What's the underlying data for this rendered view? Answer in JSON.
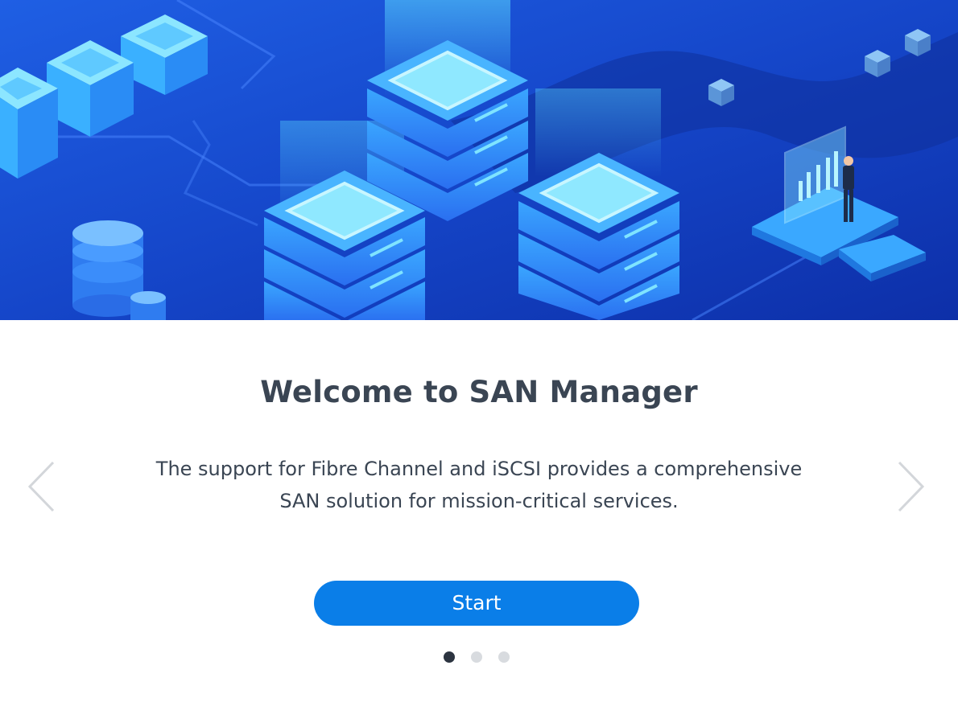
{
  "hero": {
    "illustration": "san-storage-servers-illustration",
    "bg_top": "#1e5be0",
    "bg_bottom": "#0b2d9e"
  },
  "welcome": {
    "title": "Welcome to SAN Manager",
    "description_line1": "The support for Fibre Channel and iSCSI provides a comprehensive",
    "description_line2": "SAN solution for mission-critical services."
  },
  "navigation": {
    "prev_icon": "chevron-left-icon",
    "next_icon": "chevron-right-icon"
  },
  "start_button": {
    "label": "Start",
    "color": "#0a7ee8"
  },
  "pager": {
    "total": 3,
    "active_index": 0,
    "active_color": "#2c3440",
    "inactive_color": "#d8dbdf"
  }
}
